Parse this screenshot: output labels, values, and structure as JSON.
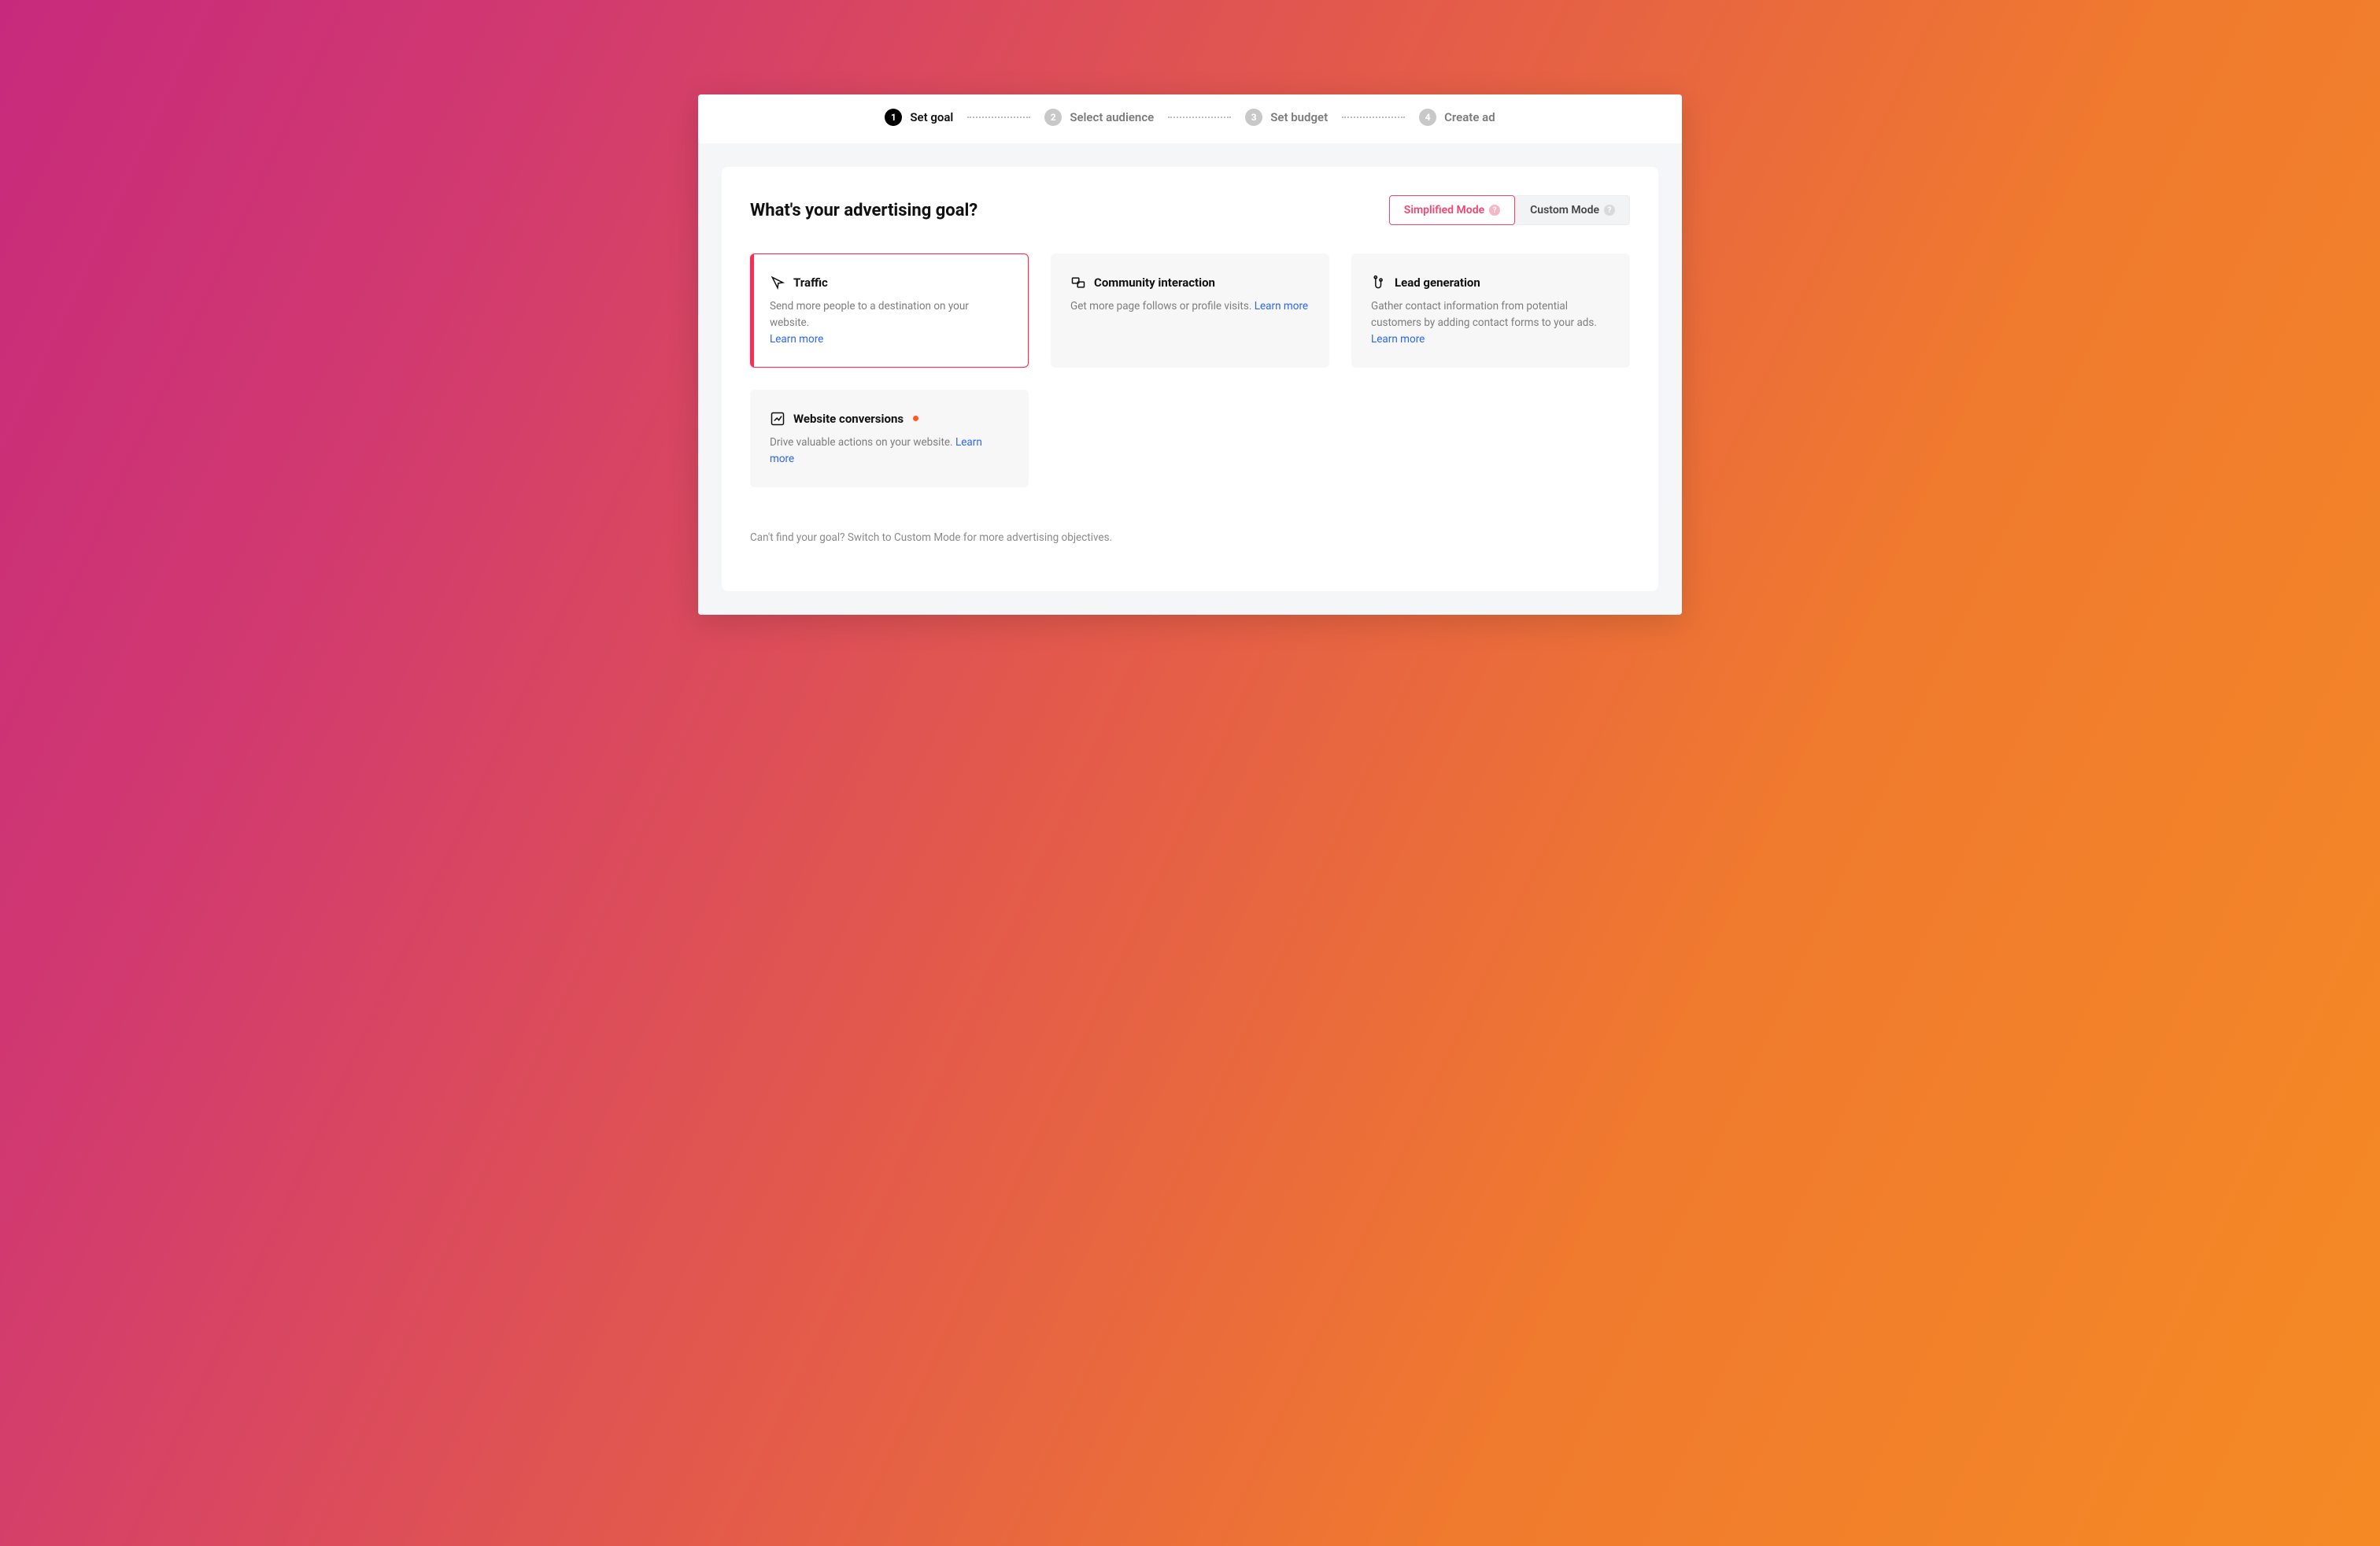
{
  "colors": {
    "accent": "#fe2c55",
    "link": "#2d66f5"
  },
  "stepper": {
    "steps": [
      {
        "num": "1",
        "label": "Set goal",
        "active": true
      },
      {
        "num": "2",
        "label": "Select audience",
        "active": false
      },
      {
        "num": "3",
        "label": "Set budget",
        "active": false
      },
      {
        "num": "4",
        "label": "Create ad",
        "active": false
      }
    ]
  },
  "panel": {
    "title": "What's your advertising goal?"
  },
  "modes": {
    "simplified": "Simplified Mode",
    "custom": "Custom Mode"
  },
  "goals": [
    {
      "name": "traffic",
      "title": "Traffic",
      "desc": "Send more people to a destination on your website.",
      "learn": "Learn more",
      "selected": true,
      "badge": false
    },
    {
      "name": "community",
      "title": "Community interaction",
      "desc": "Get more page follows or profile visits.",
      "learn": "Learn more",
      "selected": false,
      "badge": false
    },
    {
      "name": "lead",
      "title": "Lead generation",
      "desc": "Gather contact information from potential customers by adding contact forms to your ads.",
      "learn": "Learn more",
      "selected": false,
      "badge": false
    },
    {
      "name": "conversions",
      "title": "Website conversions",
      "desc": "Drive valuable actions on your website.",
      "learn": "Learn more",
      "selected": false,
      "badge": true
    }
  ],
  "footer_hint": "Can't find your goal? Switch to Custom Mode for more advertising objectives."
}
